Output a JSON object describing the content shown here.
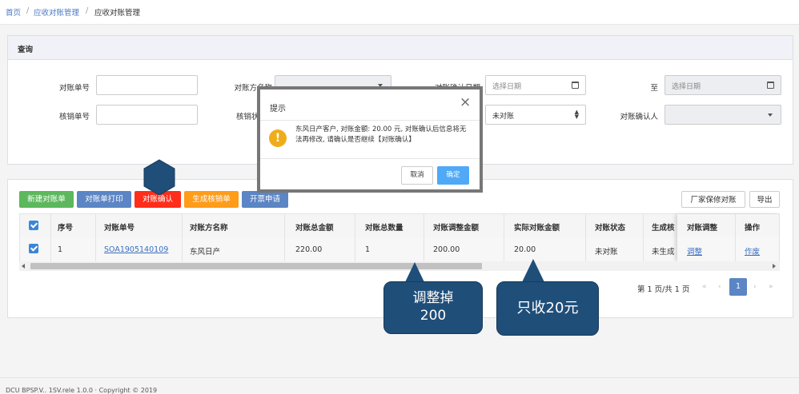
{
  "breadcrumb": {
    "home": "首页",
    "sep1": "/",
    "parent": "应收对账管理",
    "sep2": "/",
    "current": "应收对账管理"
  },
  "query_panel": {
    "title": "查询",
    "fields": {
      "bill_no": {
        "label": "对账单号",
        "value": ""
      },
      "party_name": {
        "label": "对账方名称"
      },
      "confirm_date": {
        "label": "对账确认日期",
        "placeholder": "选择日期"
      },
      "to": {
        "label": "至",
        "placeholder": "选择日期"
      },
      "writeoff_no": {
        "label": "核销单号",
        "value": ""
      },
      "writeoff_label": {
        "label": "核销状"
      },
      "status": {
        "value": "未对账"
      },
      "confirmer": {
        "label": "对账确认人"
      }
    }
  },
  "toolbar": {
    "new": "新建对账单",
    "print": "对账单打印",
    "confirm": "对账确认",
    "gen_writeoff": "生成核销单",
    "invoice": "开票申请",
    "factory_warranty": "厂家保修对账",
    "export": "导出"
  },
  "table": {
    "headers": [
      "序号",
      "对账单号",
      "对账方名称",
      "对账总金额",
      "对账总数量",
      "对账调整金额",
      "实际对账金额",
      "对账状态",
      "生成核"
    ],
    "fixed_headers": [
      "对账调整",
      "操作"
    ],
    "rows": [
      {
        "seq": "1",
        "bill_no": "SOA1905140109",
        "party": "东风日产",
        "total_amount": "220.00",
        "total_qty": "1",
        "adjust_amount": "200.00",
        "actual_amount": "20.00",
        "status": "未对账",
        "gen": "未生成",
        "adjust_link": "调整",
        "action_link": "作废"
      }
    ]
  },
  "pagination": {
    "info": "第 1 页/共 1 页",
    "first": "«",
    "prev": "‹",
    "page": "1",
    "next": "›",
    "last": "»"
  },
  "footer": {
    "text": "DCU BPSP.V.. 1SV.rele 1.0.0 · Copyright © 2019"
  },
  "dialog": {
    "title": "提示",
    "close": "×",
    "icon": "!",
    "message": "东风日产客户, 对账金额: 20.00 元, 对账确认后信息将无法再修改, 请确认是否继续【对账确认】",
    "cancel": "取消",
    "ok": "确定"
  },
  "callouts": {
    "adjust": "调整掉\n200",
    "actual": "只收20元"
  },
  "colors": {
    "green": "#5cb85c",
    "blue": "#5b85c4",
    "red": "#ff2d1a",
    "orange": "#ff9c1a",
    "callout": "#1f4e79",
    "primary": "#4fa9f7",
    "warning": "#f0ad1a"
  }
}
